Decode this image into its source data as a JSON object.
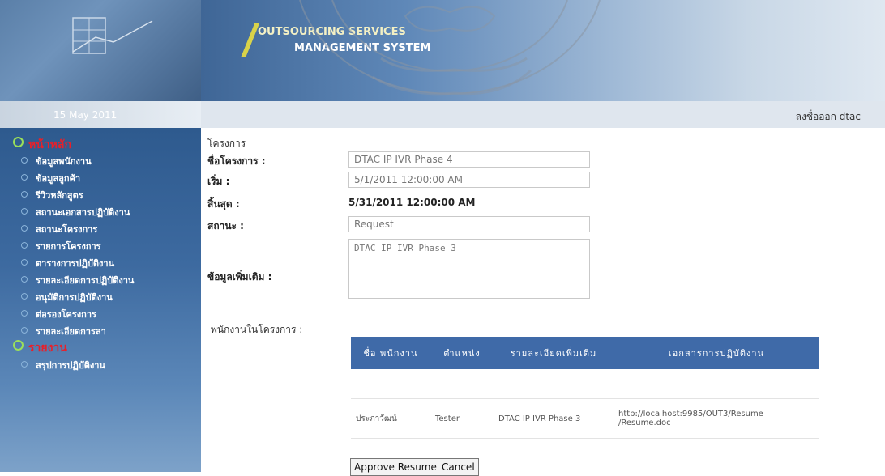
{
  "header": {
    "system_line1": "OUTSOURCING SERVICES",
    "system_line2": "MANAGEMENT SYSTEM"
  },
  "status": {
    "date": "15 May 2011",
    "logout_text": "ลงชื่อออก dtac"
  },
  "sidebar": {
    "sections": [
      {
        "title": "หน้าหลัก",
        "items": [
          "ข้อมูลพนักงาน",
          "ข้อมูลลูกค้า",
          "รีวิวหลักสูตร",
          "สถานะเอกสารปฏิบัติงาน",
          "สถานะโครงการ",
          "รายการโครงการ",
          "ตารางการปฏิบัติงาน",
          "รายละเอียดการปฏิบัติงาน",
          "อนุมัติการปฏิบัติงาน",
          "ต่อรองโครงการ",
          "รายละเอียดการลา"
        ]
      },
      {
        "title": "รายงาน",
        "items": [
          "สรุปการปฏิบัติงาน"
        ]
      }
    ]
  },
  "main": {
    "section_title": "โครงการ",
    "fields": {
      "name_label": "ชื่อโครงการ :",
      "name_value": "DTAC IP IVR Phase 4",
      "start_label": "เริ่ม :",
      "start_value": "5/1/2011 12:00:00 AM",
      "end_label": "สิ้นสุด :",
      "end_value": "5/31/2011 12:00:00 AM",
      "status_label": "สถานะ :",
      "status_value": "Request",
      "extra_label": "ข้อมูลเพิ่มเติม :",
      "extra_value": "DTAC IP IVR Phase 3"
    },
    "employees_label": "พนักงานในโครงการ :",
    "table": {
      "headers": [
        "ชื่อ พนักงาน",
        "ตำแหน่ง",
        "รายละเอียดเพิ่มเติม",
        "เอกสารการปฏิบัติงาน"
      ],
      "rows": [
        [
          "ประภาวัฒน์",
          "Tester",
          "DTAC IP IVR Phase 3",
          "http://localhost:9985/OUT3/Resume /Resume.doc"
        ]
      ]
    },
    "buttons": {
      "approve": "Approve Resume",
      "cancel": "Cancel"
    }
  },
  "colors": {
    "sidebar_bg": "#3d6aa0",
    "table_header_bg": "#3f6aa8",
    "menu_heading": "#e8202a"
  }
}
